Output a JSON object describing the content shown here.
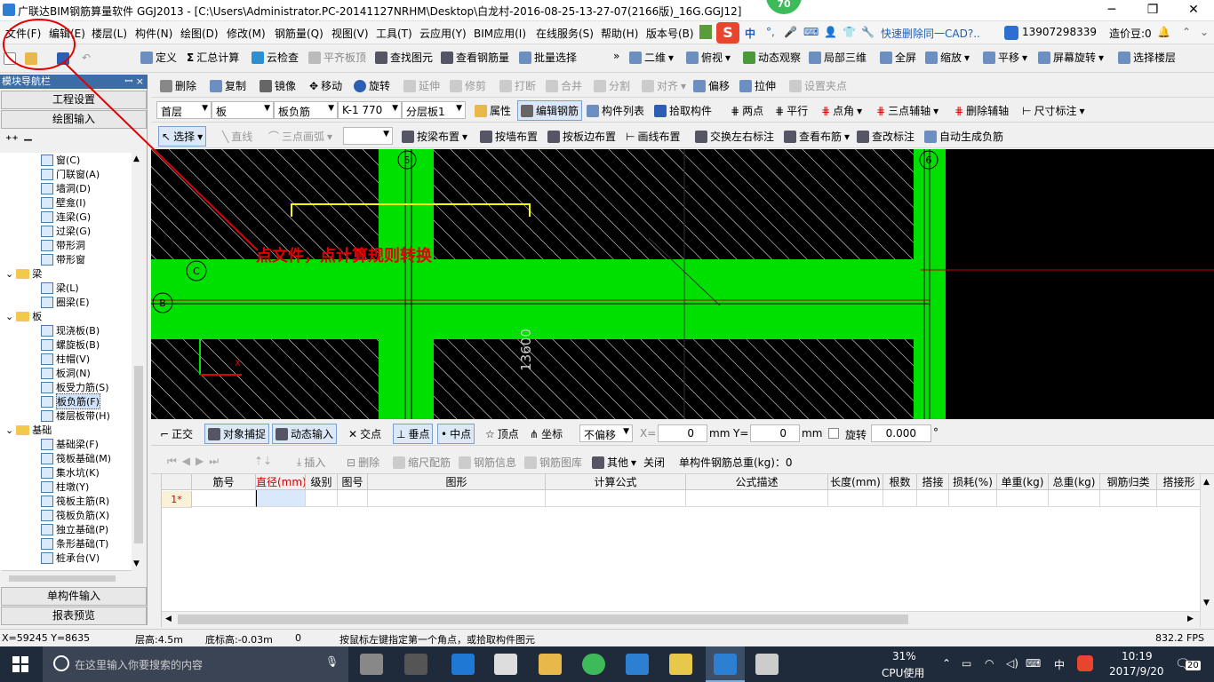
{
  "window": {
    "title": "广联达BIM钢筋算量软件 GGJ2013 - [C:\\Users\\Administrator.PC-20141127NRHM\\Desktop\\白龙村-2016-08-25-13-27-07(2166版)_16G.GGJ12]",
    "badge": "70",
    "minimize": "─",
    "maximize": "❐",
    "close": "✕"
  },
  "menu": {
    "items": [
      "文件(F)",
      "编辑(E)",
      "楼层(L)",
      "构件(N)",
      "绘图(D)",
      "修改(M)",
      "钢筋量(Q)",
      "视图(V)",
      "工具(T)",
      "云应用(Y)",
      "BIM应用(I)",
      "在线服务(S)",
      "帮助(H)",
      "版本号(B)"
    ],
    "ime": [
      "S",
      "中",
      "°,",
      "🎤",
      "⌨",
      "👤",
      "👕",
      "🔧"
    ],
    "ad_text": "快速删除同一CAD?..",
    "phone": "13907298339",
    "beans": "造价豆:0"
  },
  "toolbar1": {
    "items": [
      "定义",
      "汇总计算",
      "云检查",
      "平齐板顶",
      "查找图元",
      "查看钢筋量",
      "批量选择",
      "二维",
      "俯视",
      "动态观察",
      "局部三维",
      "全屏",
      "缩放",
      "平移",
      "屏幕旋转",
      "选择楼层"
    ]
  },
  "toolbar2": {
    "items": [
      "删除",
      "复制",
      "镜像",
      "移动",
      "旋转",
      "延伸",
      "修剪",
      "打断",
      "合并",
      "分割",
      "对齐",
      "偏移",
      "拉伸",
      "设置夹点"
    ]
  },
  "toolbar3": {
    "floor": "首层",
    "category": "板",
    "type": "板负筋",
    "element": "K-1 770",
    "layer": "分层板1",
    "items": [
      "属性",
      "编辑钢筋",
      "构件列表",
      "拾取构件",
      "两点",
      "平行",
      "点角",
      "三点辅轴",
      "删除辅轴",
      "尺寸标注"
    ]
  },
  "toolbar4": {
    "items": [
      "选择",
      "直线",
      "三点画弧",
      "按梁布置",
      "按墙布置",
      "按板边布置",
      "画线布置",
      "交换左右标注",
      "查看布筋",
      "查改标注",
      "自动生成负筋"
    ],
    "combo_value": ""
  },
  "nav": {
    "title": "模块导航栏",
    "pin": "ꟷ ×",
    "btn_project": "工程设置",
    "btn_draw": "绘图输入",
    "btn_single": "单构件输入",
    "btn_report": "报表预览",
    "tree": [
      {
        "label": "窗(C)",
        "level": 2
      },
      {
        "label": "门联窗(A)",
        "level": 2
      },
      {
        "label": "墙洞(D)",
        "level": 2
      },
      {
        "label": "壁龛(I)",
        "level": 2
      },
      {
        "label": "连梁(G)",
        "level": 2
      },
      {
        "label": "过梁(G)",
        "level": 2
      },
      {
        "label": "带形洞",
        "level": 2
      },
      {
        "label": "带形窗",
        "level": 2
      },
      {
        "label": "梁",
        "level": 1
      },
      {
        "label": "梁(L)",
        "level": 2
      },
      {
        "label": "圈梁(E)",
        "level": 2
      },
      {
        "label": "板",
        "level": 1
      },
      {
        "label": "现浇板(B)",
        "level": 2
      },
      {
        "label": "螺旋板(B)",
        "level": 2
      },
      {
        "label": "柱帽(V)",
        "level": 2
      },
      {
        "label": "板洞(N)",
        "level": 2
      },
      {
        "label": "板受力筋(S)",
        "level": 2
      },
      {
        "label": "板负筋(F)",
        "level": 2
      },
      {
        "label": "楼层板带(H)",
        "level": 2
      },
      {
        "label": "基础",
        "level": 1
      },
      {
        "label": "基础梁(F)",
        "level": 2
      },
      {
        "label": "筏板基础(M)",
        "level": 2
      },
      {
        "label": "集水坑(K)",
        "level": 2
      },
      {
        "label": "柱墩(Y)",
        "level": 2
      },
      {
        "label": "筏板主筋(R)",
        "level": 2
      },
      {
        "label": "筏板负筋(X)",
        "level": 2
      },
      {
        "label": "独立基础(P)",
        "level": 2
      },
      {
        "label": "条形基础(T)",
        "level": 2
      },
      {
        "label": "桩承台(V)",
        "level": 2
      }
    ]
  },
  "canvas": {
    "annotation": "点文件，点计算规则转换",
    "dimension": "13600",
    "axis_labels": [
      "5",
      "6",
      "C",
      "B"
    ],
    "colors": {
      "slab": "#00e000",
      "bg": "#000000",
      "annotation": "#e00000",
      "rebar": "#ffff00"
    }
  },
  "snapbar": {
    "items": [
      "正交",
      "对象捕捉",
      "动态输入",
      "交点",
      "垂点",
      "中点",
      "顶点",
      "坐标"
    ],
    "offset_mode": "不偏移",
    "x_label": "X=",
    "x_value": "0",
    "y_label": "Y=",
    "y_value": "0",
    "unit": "mm",
    "rotate_label": "旋转",
    "rotate_value": "0.000",
    "degree": "°"
  },
  "gridbar": {
    "items": [
      "插入",
      "删除",
      "缩尺配筋",
      "钢筋信息",
      "钢筋图库",
      "其他",
      "关闭"
    ],
    "total": "单构件钢筋总重(kg)：0"
  },
  "grid": {
    "headers": [
      "筋号",
      "直径(mm)",
      "级别",
      "图号",
      "图形",
      "计算公式",
      "公式描述",
      "长度(mm)",
      "根数",
      "搭接",
      "损耗(%)",
      "单重(kg)",
      "总重(kg)",
      "钢筋归类",
      "搭接形"
    ],
    "row_label": "1*"
  },
  "status": {
    "coords": "X=59245 Y=8635",
    "floor_height": "层高:4.5m",
    "base_height": "底标高:-0.03m",
    "zero": "0",
    "hint": "按鼠标左键指定第一个角点，或拾取构件图元",
    "fps": "832.2 FPS"
  },
  "taskbar": {
    "search_placeholder": "在这里输入你要搜索的内容",
    "cpu_percent": "31%",
    "cpu_label": "CPU使用",
    "time": "10:19",
    "date": "2017/9/20",
    "ime": "中",
    "notify": "20"
  }
}
